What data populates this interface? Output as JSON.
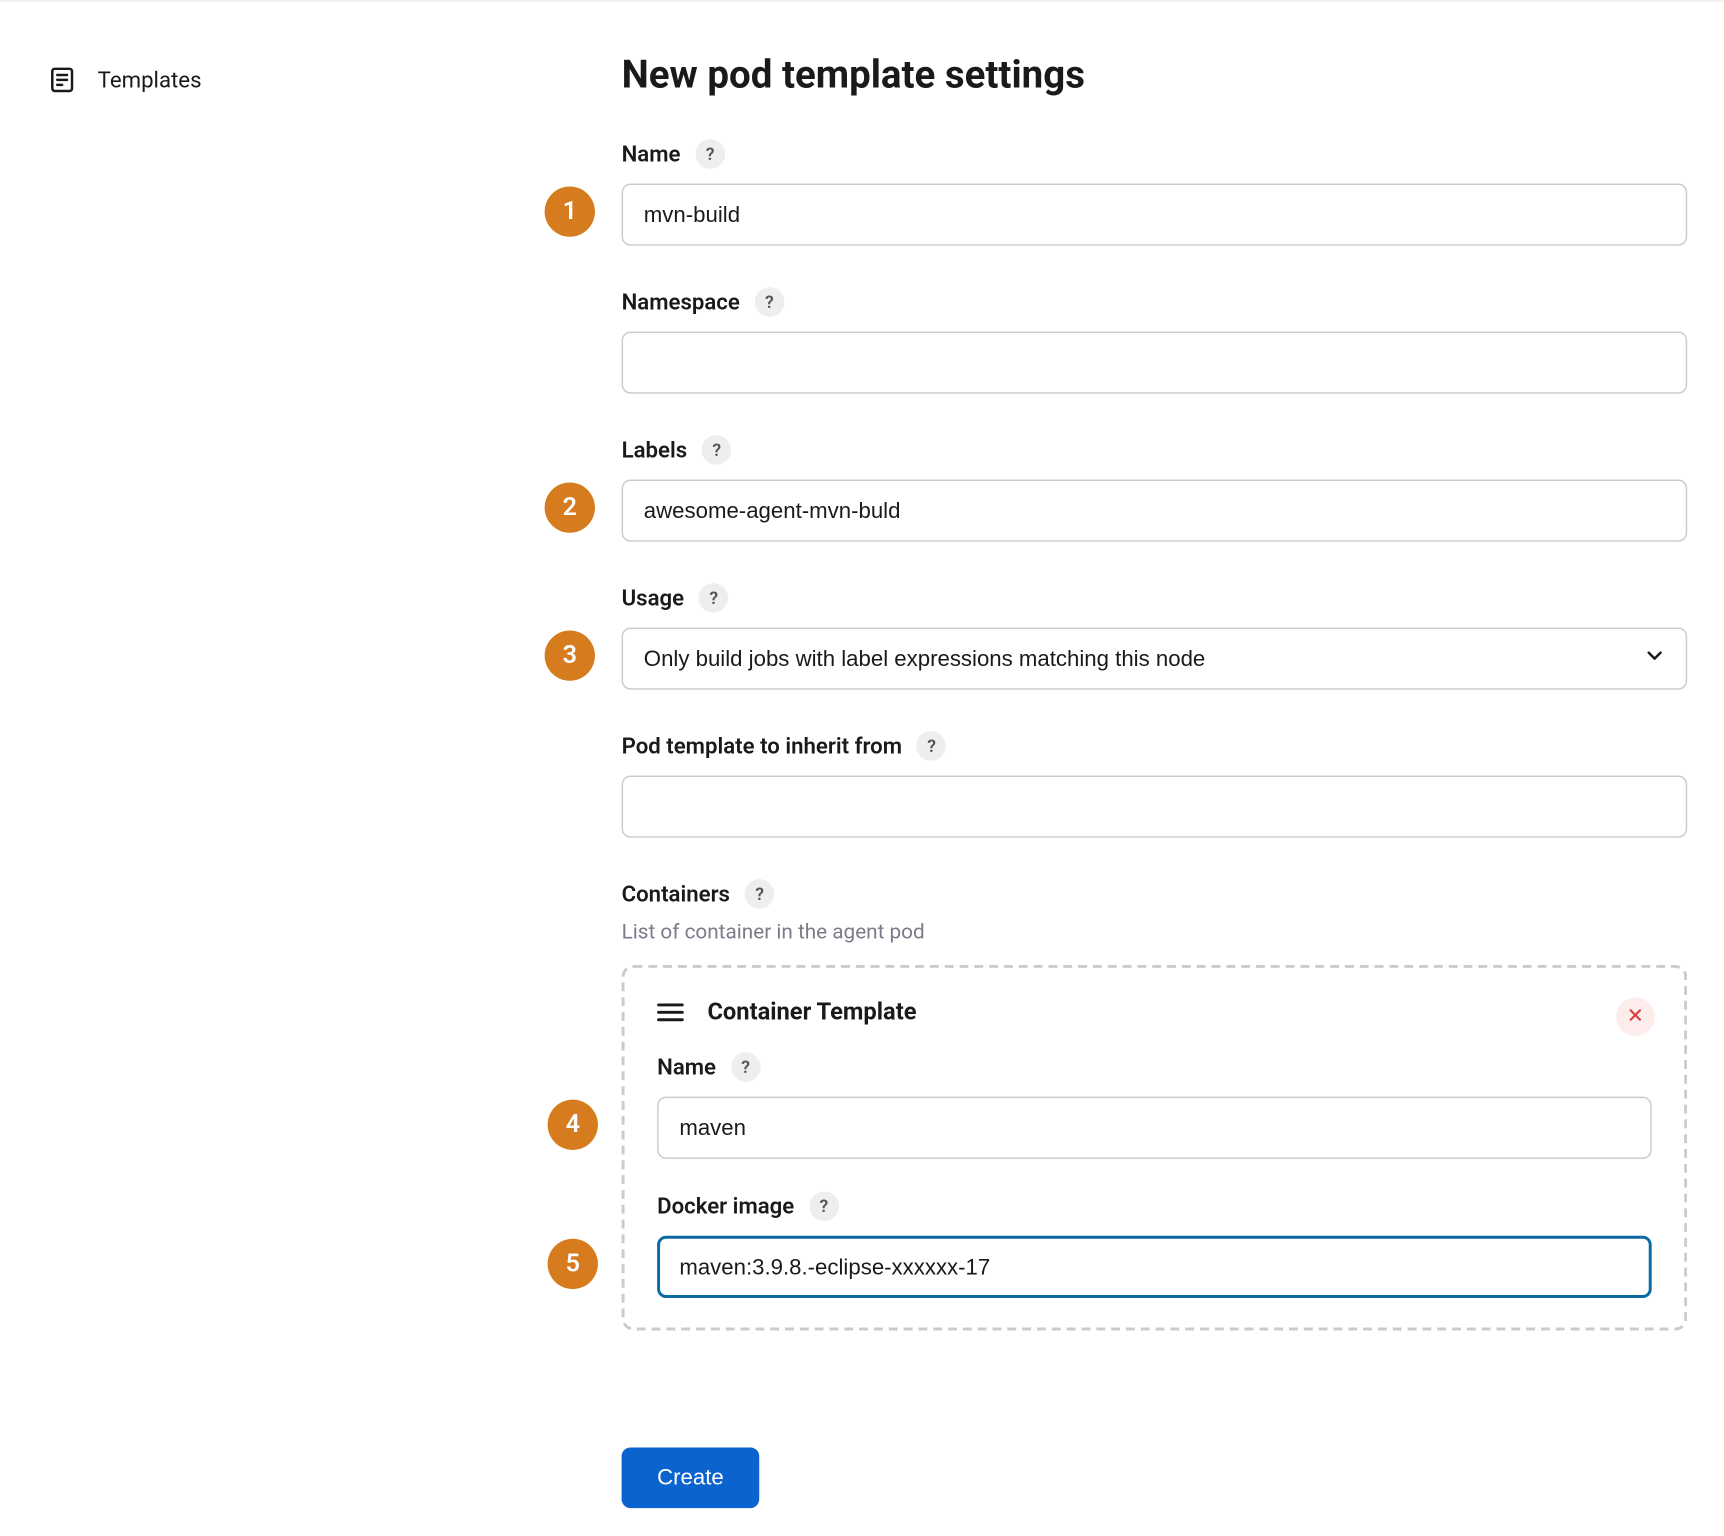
{
  "sidebar": {
    "label": "Templates"
  },
  "page": {
    "title": "New pod template settings"
  },
  "fields": {
    "name": {
      "label": "Name",
      "value": "mvn-build"
    },
    "namespace": {
      "label": "Namespace",
      "value": ""
    },
    "labels": {
      "label": "Labels",
      "value": "awesome-agent-mvn-buld"
    },
    "usage": {
      "label": "Usage",
      "value": "Only build jobs with label expressions matching this node"
    },
    "inherit": {
      "label": "Pod template to inherit from",
      "value": ""
    },
    "containers": {
      "label": "Containers",
      "description": "List of container in the agent pod"
    }
  },
  "container": {
    "title": "Container Template",
    "name": {
      "label": "Name",
      "value": "maven"
    },
    "docker": {
      "label": "Docker image",
      "value": "maven:3.9.8.-eclipse-xxxxxx-17"
    }
  },
  "steps": {
    "s1": "1",
    "s2": "2",
    "s3": "3",
    "s4": "4",
    "s5": "5"
  },
  "buttons": {
    "create": "Create"
  },
  "help": "?"
}
